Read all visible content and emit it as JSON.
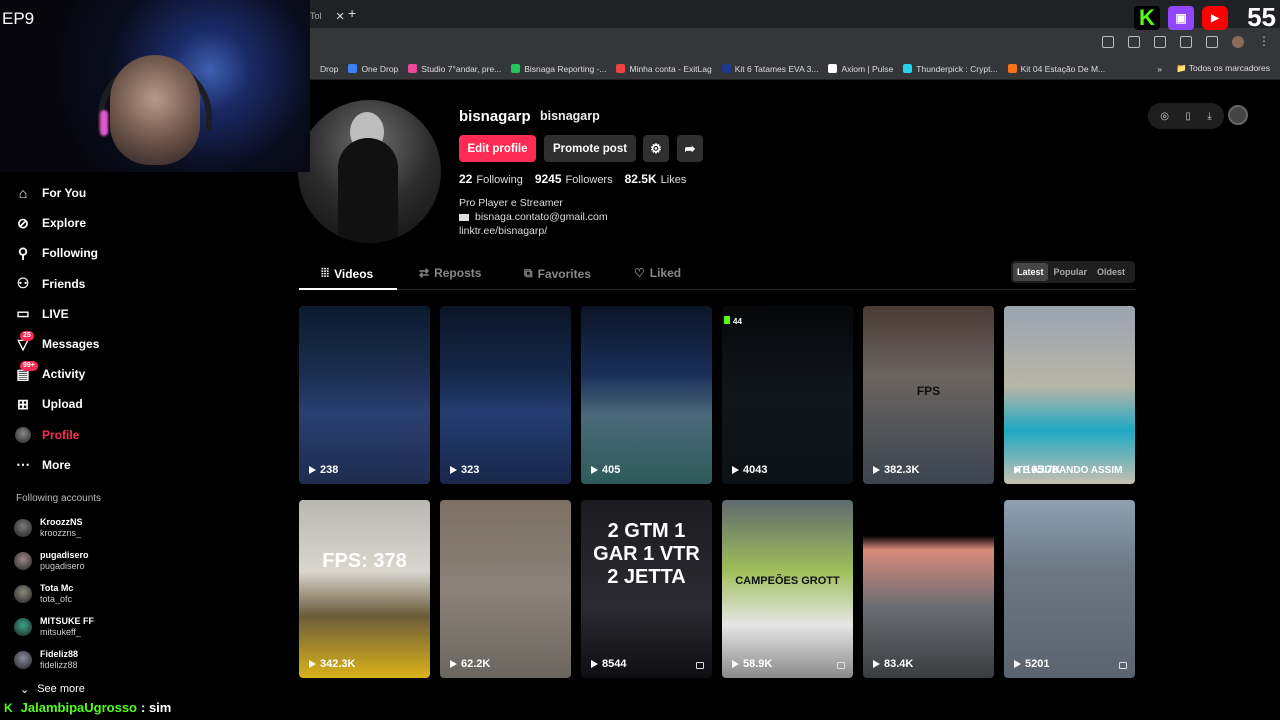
{
  "browser": {
    "tab_title": "Tol",
    "bookmarks": [
      "Drop",
      "One Drop",
      "Studio 7°andar, pre...",
      "Bisnaga Reporting -...",
      "Minha conta - ExitLag",
      "Kit 6 Tatames EVA 3...",
      "Axiom | Pulse",
      "Thunderpick : Crypt...",
      "Kit 04 Estação De M..."
    ],
    "bookmarks_folder": "Todos os marcadores"
  },
  "stream": {
    "episode": "EP9",
    "viewer_count": "55",
    "chat_user": "JalambipaUgrosso",
    "chat_message": ": sim",
    "platform_icons": [
      "kick-icon",
      "twitch-icon",
      "youtube-icon"
    ]
  },
  "nav": {
    "items": [
      {
        "label": "For You",
        "icon": "home-icon",
        "badge": ""
      },
      {
        "label": "Explore",
        "icon": "compass-icon",
        "badge": ""
      },
      {
        "label": "Following",
        "icon": "user-follow-icon",
        "badge": ""
      },
      {
        "label": "Friends",
        "icon": "friends-icon",
        "badge": ""
      },
      {
        "label": "LIVE",
        "icon": "live-icon",
        "badge": ""
      },
      {
        "label": "Messages",
        "icon": "messages-icon",
        "badge": "25"
      },
      {
        "label": "Activity",
        "icon": "activity-icon",
        "badge": "99+"
      },
      {
        "label": "Upload",
        "icon": "upload-icon",
        "badge": ""
      },
      {
        "label": "Profile",
        "icon": "avatar",
        "badge": ""
      },
      {
        "label": "More",
        "icon": "more-icon",
        "badge": ""
      }
    ],
    "following_header": "Following accounts",
    "following": [
      {
        "name": "KroozzNS",
        "handle": "kroozzns_"
      },
      {
        "name": "pugadisero",
        "handle": "pugadisero"
      },
      {
        "name": "Tota Mc",
        "handle": "tota_ofc"
      },
      {
        "name": "MITSUKE FF",
        "handle": "mitsukeff_"
      },
      {
        "name": "Fideliz88",
        "handle": "fidelizz88"
      }
    ],
    "see_more": "See more"
  },
  "profile": {
    "username": "bisnagarp",
    "nickname": "bisnagarp",
    "edit_label": "Edit profile",
    "promote_label": "Promote post",
    "following_count": "22",
    "following_label": "Following",
    "followers_count": "9245",
    "followers_label": "Followers",
    "likes_count": "82.5K",
    "likes_label": "Likes",
    "bio_line1": "Pro Player e Streamer",
    "bio_email": "bisnaga.contato@gmail.com",
    "bio_link": "linktr.ee/bisnagarp/"
  },
  "tabs": [
    "Videos",
    "Reposts",
    "Favorites",
    "Liked"
  ],
  "sort": [
    "Latest",
    "Popular",
    "Oldest"
  ],
  "videos": [
    {
      "views": "238",
      "locked": false,
      "text": "",
      "bg": "linear-gradient(180deg,#0b1a2c 0%,#1d2f52 40%,#2a3f72 60%,#1e2c4d 100%)"
    },
    {
      "views": "323",
      "locked": false,
      "text": "",
      "bg": "linear-gradient(180deg,#0b1526 0%,#16294c 40%,#253d72 60%,#17264a 100%)"
    },
    {
      "views": "405",
      "locked": false,
      "text": "",
      "bg": "linear-gradient(180deg,#0a1526 0%,#1a2e57 38%,#4b6a7a 62%,#2e5a5a 100%)"
    },
    {
      "views": "4043",
      "locked": false,
      "text": "",
      "pin": "44",
      "bg": "linear-gradient(180deg,#050709 0%,#11161c 50%,#0b1216 100%)"
    },
    {
      "views": "382.3K",
      "locked": false,
      "text": "FPS",
      "bg": "linear-gradient(180deg,#4a3a35 0%,#6a6460 40%,#3b4450 100%)"
    },
    {
      "views": "165.7K",
      "locked": false,
      "text": "TE AJUDANDO ASSIM",
      "bg": "linear-gradient(180deg,#9aa3b0 0%,#b9b6a7 45%,#1fa8c2 70%,#c7bfb2 100%)"
    },
    {
      "views": "342.3K",
      "locked": false,
      "text": "FPS: 378",
      "bg": "linear-gradient(180deg,#b8b8b0 0%,#d9d6cf 40%,#6b5c3a 65%,#dab21a 100%)"
    },
    {
      "views": "62.2K",
      "locked": false,
      "text": "",
      "bg": "linear-gradient(180deg,#7a7064 0%,#8c8378 50%,#6a6660 100%)"
    },
    {
      "views": "8544",
      "locked": true,
      "text": "2 GTM 1 GAR 1 VTR 2 JETTA",
      "bg": "linear-gradient(180deg,#1c1c20 0%,#2a2a30 60%,#0e0e12 100%)"
    },
    {
      "views": "58.9K",
      "locked": true,
      "text": "CAMPEÕES GROTT",
      "bg": "linear-gradient(180deg,#5f6a6f 0%,#9fbf5a 40%,#e6e6e6 70%,#8a8a8a 100%)"
    },
    {
      "views": "83.4K",
      "locked": false,
      "text": "",
      "bg": "linear-gradient(180deg,#000 0%,#000 20%,#d98a7a 28%,#6a6e72 60%,#3a3d40 100%)"
    },
    {
      "views": "5201",
      "locked": true,
      "text": "",
      "bg": "linear-gradient(180deg,#8ea0b2 0%,#6b7884 40%,#5a6470 100%)"
    }
  ]
}
